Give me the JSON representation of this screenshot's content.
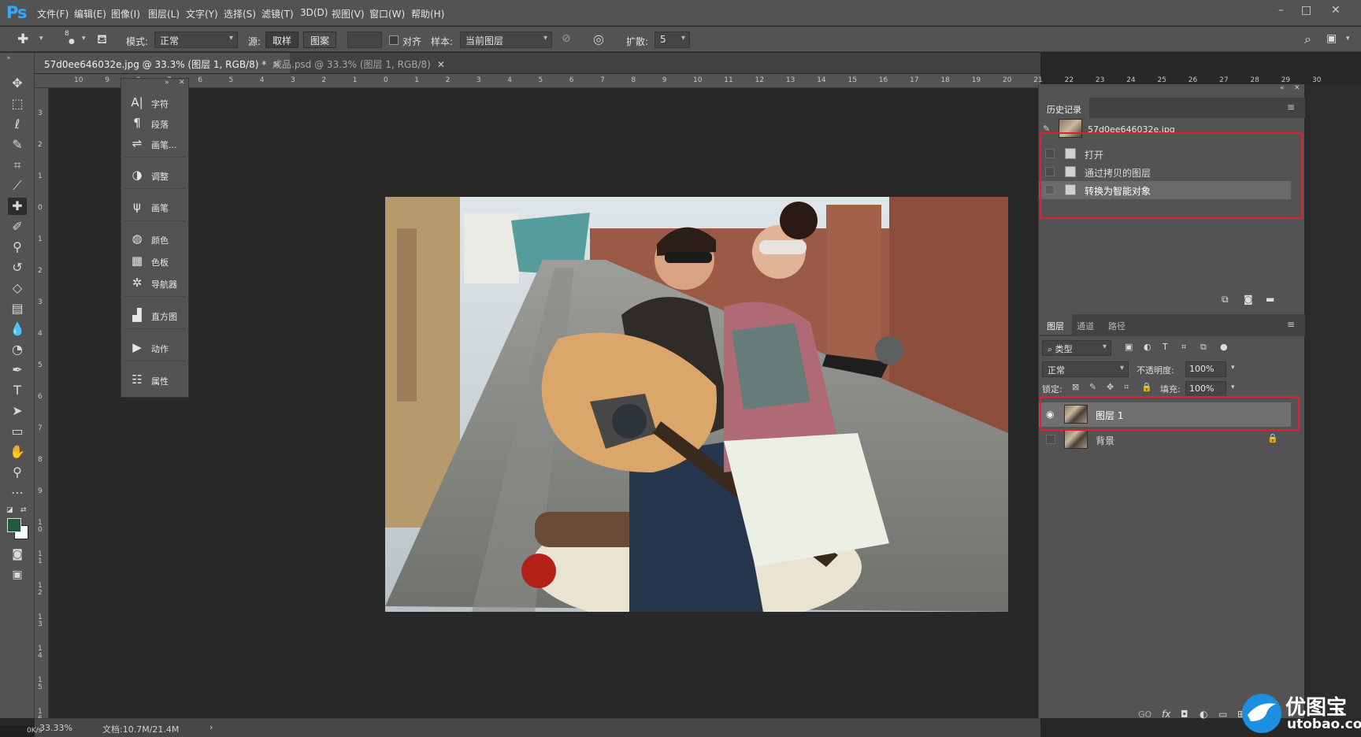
{
  "app": {
    "logo": "Ps",
    "menu": [
      "文件(F)",
      "编辑(E)",
      "图像(I)",
      "图层(L)",
      "文字(Y)",
      "选择(S)",
      "滤镜(T)",
      "3D(D)",
      "视图(V)",
      "窗口(W)",
      "帮助(H)"
    ],
    "window_controls": [
      "–",
      "□",
      "✕"
    ]
  },
  "options": {
    "brush_size": "8",
    "mode_label": "模式:",
    "mode_value": "正常",
    "source_label": "源:",
    "sampled_btn": "取样",
    "pattern_btn": "图案",
    "align_label": "对齐",
    "sample_label": "样本:",
    "sample_value": "当前图层",
    "diffusion_label": "扩散:",
    "diffusion_value": "5"
  },
  "tabs": [
    {
      "label": "57d0ee646032e.jpg @ 33.3% (图层 1, RGB/8) *",
      "close": "✕"
    },
    {
      "label": "成品.psd @ 33.3% (图层 1, RGB/8)",
      "close": "✕"
    }
  ],
  "ruler": {
    "top": [
      "10",
      "9",
      "8",
      "7",
      "6",
      "5",
      "4",
      "3",
      "2",
      "1",
      "0",
      "1",
      "2",
      "3",
      "4",
      "5",
      "6",
      "7",
      "8",
      "9",
      "10",
      "11",
      "12",
      "13",
      "14",
      "15",
      "16",
      "17",
      "18",
      "19",
      "20",
      "21",
      "22",
      "23",
      "24",
      "25",
      "26",
      "27",
      "28",
      "29",
      "30"
    ],
    "left": [
      "3",
      "2",
      "1",
      "0",
      "1",
      "2",
      "3",
      "4",
      "5",
      "6",
      "7",
      "8",
      "9",
      "1\n0",
      "1\n1",
      "1\n2",
      "1\n3",
      "1\n4",
      "1\n5",
      "1\n6"
    ]
  },
  "flyout": {
    "items": [
      {
        "icon": "A|",
        "label": "字符"
      },
      {
        "icon": "¶",
        "label": "段落"
      },
      {
        "icon": "⇌",
        "label": "画笔..."
      },
      {
        "icon": "◑",
        "label": "调整"
      },
      {
        "icon": "ψ",
        "label": "画笔"
      },
      {
        "icon": "◍",
        "label": "颜色"
      },
      {
        "icon": "▦",
        "label": "色板"
      },
      {
        "icon": "✲",
        "label": "导航器"
      },
      {
        "icon": "▟",
        "label": "直方图"
      },
      {
        "icon": "▶",
        "label": "动作"
      },
      {
        "icon": "☷",
        "label": "属性"
      }
    ]
  },
  "history": {
    "tab": "历史记录",
    "snapshot": "57d0ee646032e.jpg",
    "steps": [
      "打开",
      "通过拷贝的图层",
      "转换为智能对象"
    ]
  },
  "layers": {
    "tabs": [
      "图层",
      "通道",
      "路径"
    ],
    "filter_label": "类型",
    "blend_mode": "正常",
    "opacity_label": "不透明度:",
    "opacity_value": "100%",
    "lock_label": "锁定:",
    "fill_label": "填充:",
    "fill_value": "100%",
    "items": [
      {
        "name": "图层 1",
        "selected": true
      },
      {
        "name": "背景",
        "locked": true
      }
    ],
    "footer_icons": [
      "GO",
      "fx",
      "◘",
      "◐",
      "▭",
      "⊞",
      "🗑"
    ]
  },
  "status": {
    "zoom": "33.33%",
    "doc_info": "文档:10.7M/21.4M",
    "speed": "0K/s"
  },
  "watermark": {
    "cn": "优图宝",
    "en": "utobao.com"
  },
  "colors": {
    "accent_red": "#e0202a",
    "ps_blue": "#31a8ff"
  }
}
